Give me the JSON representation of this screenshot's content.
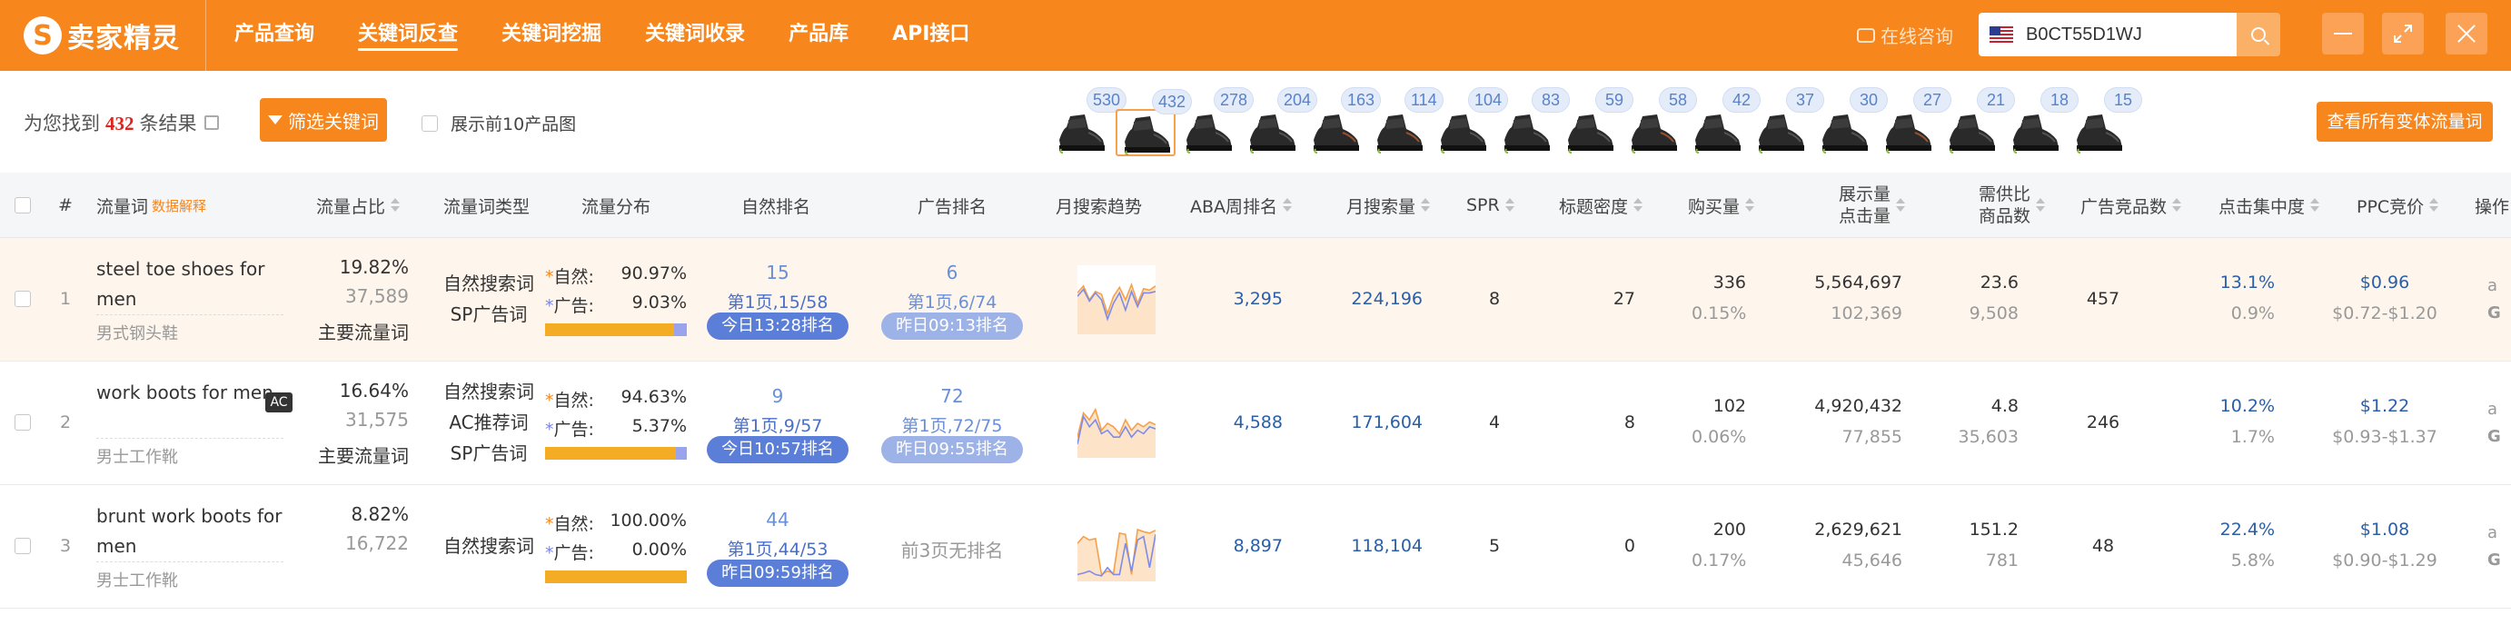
{
  "header": {
    "logo_text": "卖家精灵",
    "nav": [
      "产品查询",
      "关键词反查",
      "关键词挖掘",
      "关键词收录",
      "产品库",
      "API接口"
    ],
    "active_nav": 1,
    "consult_label": "在线咨询",
    "search_value": "B0CT55D1WJ",
    "colors": {
      "brand": "#f7861c"
    }
  },
  "toolbar": {
    "found_prefix": "为您找到",
    "found_count": "432",
    "found_suffix": "条结果",
    "filter_label": "筛选关键词",
    "show_top10_label": "展示前10产品图",
    "view_all_label": "查看所有变体流量词"
  },
  "variants": [
    "530",
    "432",
    "278",
    "204",
    "163",
    "114",
    "104",
    "83",
    "59",
    "58",
    "42",
    "37",
    "30",
    "27",
    "21",
    "18",
    "15"
  ],
  "table": {
    "headers": {
      "index": "#",
      "keyword": "流量词",
      "keyword_sub": "数据解释",
      "share": "流量占比",
      "type": "流量词类型",
      "distribution": "流量分布",
      "organic_rank": "自然排名",
      "ad_rank": "广告排名",
      "trend": "月搜索趋势",
      "aba": "ABA周排名",
      "monthly_search": "月搜索量",
      "spr": "SPR",
      "title_density": "标题密度",
      "purchases": "购买量",
      "impressions_line1": "展示量",
      "impressions_line2": "点击量",
      "supply_line1": "需供比",
      "supply_line2": "商品数",
      "ad_products": "广告竞品数",
      "click_concentration": "点击集中度",
      "ppc": "PPC竞价",
      "actions": "操作"
    },
    "rows": [
      {
        "index": "1",
        "keyword": "steel toe shoes for men",
        "keyword_cn": "男式钢头鞋",
        "ac": "",
        "share_pct": "19.82%",
        "share_count": "37,589",
        "share_tag": "主要流量词",
        "types": [
          "自然搜索词",
          "SP广告词"
        ],
        "organic_label": "自然:",
        "organic_pct": "90.97%",
        "ad_label": "广告:",
        "ad_pct": "9.03%",
        "ad_fraction": 0.0903,
        "organic_rank": "15",
        "organic_page": "第1页,15/58",
        "organic_time": "今日13:28排名",
        "ad_rank": "6",
        "ad_page": "第1页,6/74",
        "ad_time": "昨日09:13排名",
        "trend": [
          0.6,
          0.7,
          0.5,
          0.62,
          0.58,
          0.3,
          0.55,
          0.68,
          0.5,
          0.72,
          0.45,
          0.66,
          0.64,
          0.7
        ],
        "trend2": [
          0.55,
          0.65,
          0.48,
          0.6,
          0.5,
          0.22,
          0.45,
          0.6,
          0.35,
          0.62,
          0.4,
          0.6,
          0.6,
          0.62
        ],
        "aba": "3,295",
        "monthly": "224,196",
        "spr": "8",
        "title_density": "27",
        "purchases": "336",
        "purchase_rate": "0.15%",
        "impressions": "5,564,697",
        "clicks": "102,369",
        "supply_ratio": "23.6",
        "products": "9,508",
        "ad_products": "457",
        "click_conc": "13.1%",
        "click_conc_sub": "0.9%",
        "ppc": "$0.96",
        "ppc_range": "$0.72-$1.20"
      },
      {
        "index": "2",
        "keyword": "work boots for men",
        "keyword_cn": "男士工作靴",
        "ac": "AC",
        "share_pct": "16.64%",
        "share_count": "31,575",
        "share_tag": "主要流量词",
        "types": [
          "自然搜索词",
          "AC推荐词",
          "SP广告词"
        ],
        "organic_label": "自然:",
        "organic_pct": "94.63%",
        "ad_label": "广告:",
        "ad_pct": "5.37%",
        "ad_fraction": 0.0537,
        "organic_rank": "9",
        "organic_page": "第1页,9/57",
        "organic_time": "今日10:57排名",
        "ad_rank": "72",
        "ad_page": "第1页,72/75",
        "ad_time": "昨日09:55排名",
        "trend": [
          0.3,
          0.65,
          0.55,
          0.7,
          0.4,
          0.5,
          0.45,
          0.35,
          0.55,
          0.4,
          0.5,
          0.45,
          0.52,
          0.48
        ],
        "trend2": [
          0.2,
          0.6,
          0.45,
          0.55,
          0.35,
          0.4,
          0.3,
          0.3,
          0.45,
          0.3,
          0.4,
          0.35,
          0.45,
          0.42
        ],
        "aba": "4,588",
        "monthly": "171,604",
        "spr": "4",
        "title_density": "8",
        "purchases": "102",
        "purchase_rate": "0.06%",
        "impressions": "4,920,432",
        "clicks": "77,855",
        "supply_ratio": "4.8",
        "products": "35,603",
        "ad_products": "246",
        "click_conc": "10.2%",
        "click_conc_sub": "1.7%",
        "ppc": "$1.22",
        "ppc_range": "$0.93-$1.37"
      },
      {
        "index": "3",
        "keyword": "brunt work boots for men",
        "keyword_cn": "男士工作靴",
        "ac": "",
        "share_pct": "8.82%",
        "share_count": "16,722",
        "share_tag": "",
        "types": [
          "自然搜索词"
        ],
        "organic_label": "自然:",
        "organic_pct": "100.00%",
        "ad_label": "广告:",
        "ad_pct": "0.00%",
        "ad_fraction": 0,
        "organic_rank": "44",
        "organic_page": "第1页,44/53",
        "organic_time": "昨日09:59排名",
        "ad_rank": "",
        "ad_page": "前3页无排名",
        "ad_time": "",
        "trend": [
          0.55,
          0.65,
          0.6,
          0.62,
          0.1,
          0.15,
          0.12,
          0.7,
          0.68,
          0.1,
          0.75,
          0.72,
          0.7,
          0.74
        ],
        "trend2": [
          0.1,
          0.12,
          0.15,
          0.1,
          0.08,
          0.2,
          0.1,
          0.1,
          0.55,
          0.15,
          0.6,
          0.65,
          0.2,
          0.68
        ],
        "aba": "8,897",
        "monthly": "118,104",
        "spr": "5",
        "title_density": "0",
        "purchases": "200",
        "purchase_rate": "0.17%",
        "impressions": "2,629,621",
        "clicks": "45,646",
        "supply_ratio": "151.2",
        "products": "781",
        "ad_products": "48",
        "click_conc": "22.4%",
        "click_conc_sub": "5.8%",
        "ppc": "$1.08",
        "ppc_range": "$0.90-$1.29"
      }
    ]
  }
}
